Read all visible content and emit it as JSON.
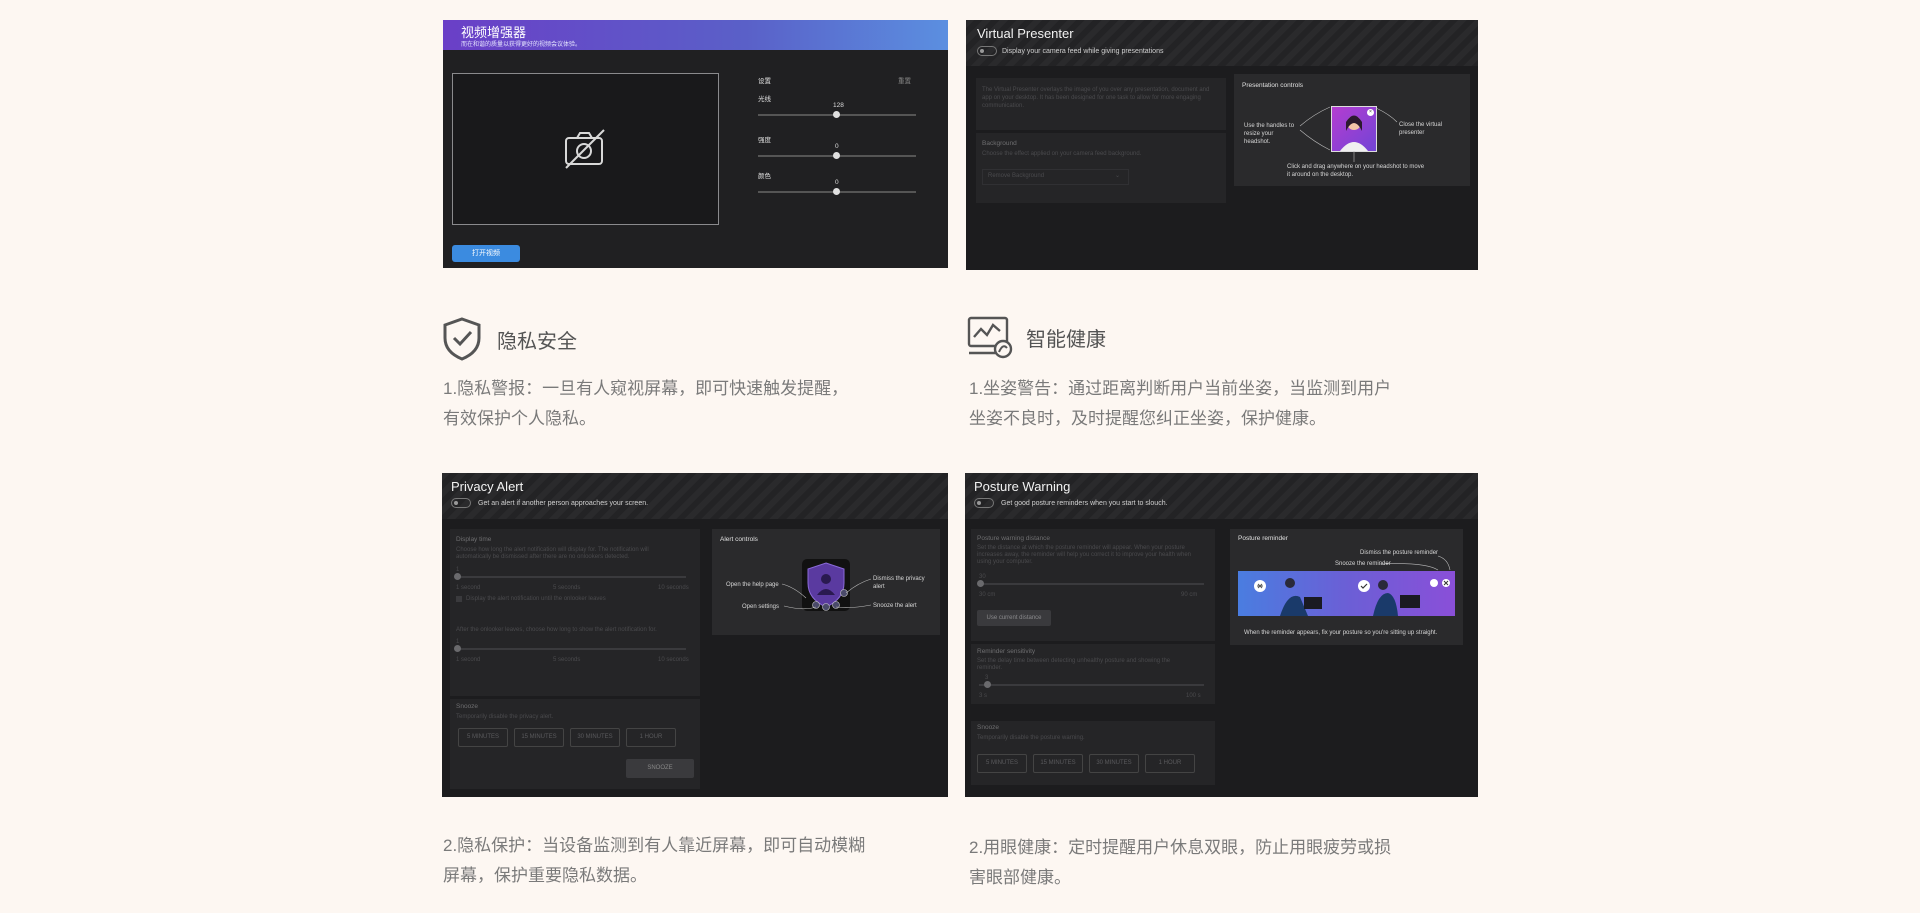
{
  "colors": {
    "page_bg": "#fdf7f2",
    "panel_bg": "#1c1c1e",
    "accent_blue": "#3b8be0",
    "purple_gradient": "#7c4fd1"
  },
  "video_enhancer": {
    "title": "视频增强器",
    "subtitle": "而在和谐的质量以获得更好的视频会议体验。",
    "settings_label": "设置",
    "reset_label": "重置",
    "sliders": [
      {
        "label": "光线",
        "value": "128"
      },
      {
        "label": "强度",
        "value": "0"
      },
      {
        "label": "颜色",
        "value": "0"
      }
    ],
    "open_video_button": "打开视频",
    "camera_off_icon": "camera-off-icon"
  },
  "virtual_presenter": {
    "title": "Virtual Presenter",
    "subtitle": "Display your camera feed while giving presentations",
    "desc": "The Virtual Presenter overlays the image of you over any presentation, document and app on your desktop. It has been designed for one task to allow for more engaging communication.",
    "background_label": "Background",
    "background_desc": "Choose the effect applied on your camera feed background.",
    "background_select": "Remove Background",
    "controls_title": "Presentation controls",
    "ann_resize": "Use the handles to resize your headshot.",
    "ann_close": "Close the virtual presenter",
    "ann_drag": "Click and drag anywhere on your headshot to move it around on the desktop."
  },
  "privacy_security": {
    "icon": "shield-check-icon",
    "title": "隐私安全",
    "text_line1": "1.隐私警报：一旦有人窥视屏幕，即可快速触发提醒，",
    "text_line2": "有效保护个人隐私。"
  },
  "smart_health": {
    "icon": "health-monitor-icon",
    "title": "智能健康",
    "text_line1": "1.坐姿警告：通过距离判断用户当前坐姿，当监测到用户",
    "text_line2": "坐姿不良时，及时提醒您纠正坐姿，保护健康。"
  },
  "privacy_alert": {
    "title": "Privacy Alert",
    "subtitle": "Get an alert if another person approaches your screen.",
    "display_time_label": "Display time",
    "display_time_desc": "Choose how long the alert notification will display for. The notification will automatically be dismissed after there are no onlookers detected.",
    "slider1_value": "1",
    "slider1_ticks": [
      "1 second",
      "5 seconds",
      "10 seconds"
    ],
    "checkbox_label": "Display the alert notification until the onlooker leaves",
    "after_leaves_desc": "After the onlooker leaves, choose how long to show the alert notification for.",
    "slider2_value": "1",
    "slider2_ticks": [
      "1 second",
      "5 seconds",
      "10 seconds"
    ],
    "snooze_label": "Snooze",
    "snooze_desc": "Temporarily disable the privacy alert.",
    "snooze_buttons": [
      "5 MINUTES",
      "15 MINUTES",
      "30 MINUTES",
      "1 HOUR"
    ],
    "snooze_action": "SNOOZE",
    "controls_title": "Alert controls",
    "ann_help": "Open the help page",
    "ann_settings": "Open settings",
    "ann_dismiss": "Dismiss the privacy alert",
    "ann_snooze": "Snooze the alert"
  },
  "posture_warning": {
    "title": "Posture Warning",
    "subtitle": "Get good posture reminders when you start to slouch.",
    "distance_label": "Posture warning distance",
    "distance_desc": "Set the distance at which the posture reminder will appear. When your posture increases away, the reminder will help you correct it to improve your health when using your computer.",
    "distance_value": "30",
    "distance_ticks": [
      "30 cm",
      "90 cm"
    ],
    "use_current_button": "Use current distance",
    "sensitivity_label": "Reminder sensitivity",
    "sensitivity_desc": "Set the delay time between detecting unhealthy posture and showing the reminder.",
    "sensitivity_value": "3",
    "sensitivity_ticks": [
      "3 s",
      "100 s"
    ],
    "snooze_label": "Snooze",
    "snooze_desc": "Temporarily disable the posture warning.",
    "snooze_buttons": [
      "5 MINUTES",
      "15 MINUTES",
      "30 MINUTES",
      "1 HOUR"
    ],
    "reminder_title": "Posture reminder",
    "ann_dismiss": "Dismiss the posture reminder",
    "ann_snooze": "Snooze the reminder",
    "ann_bottom": "When the reminder appears, fix your posture so you're sitting up straight."
  },
  "privacy_protect": {
    "text_line1": "2.隐私保护：当设备监测到有人靠近屏幕，即可自动模糊",
    "text_line2": "屏幕，保护重要隐私数据。"
  },
  "eye_health": {
    "text_line1": "2.用眼健康：定时提醒用户休息双眼，防止用眼疲劳或损",
    "text_line2": "害眼部健康。"
  }
}
